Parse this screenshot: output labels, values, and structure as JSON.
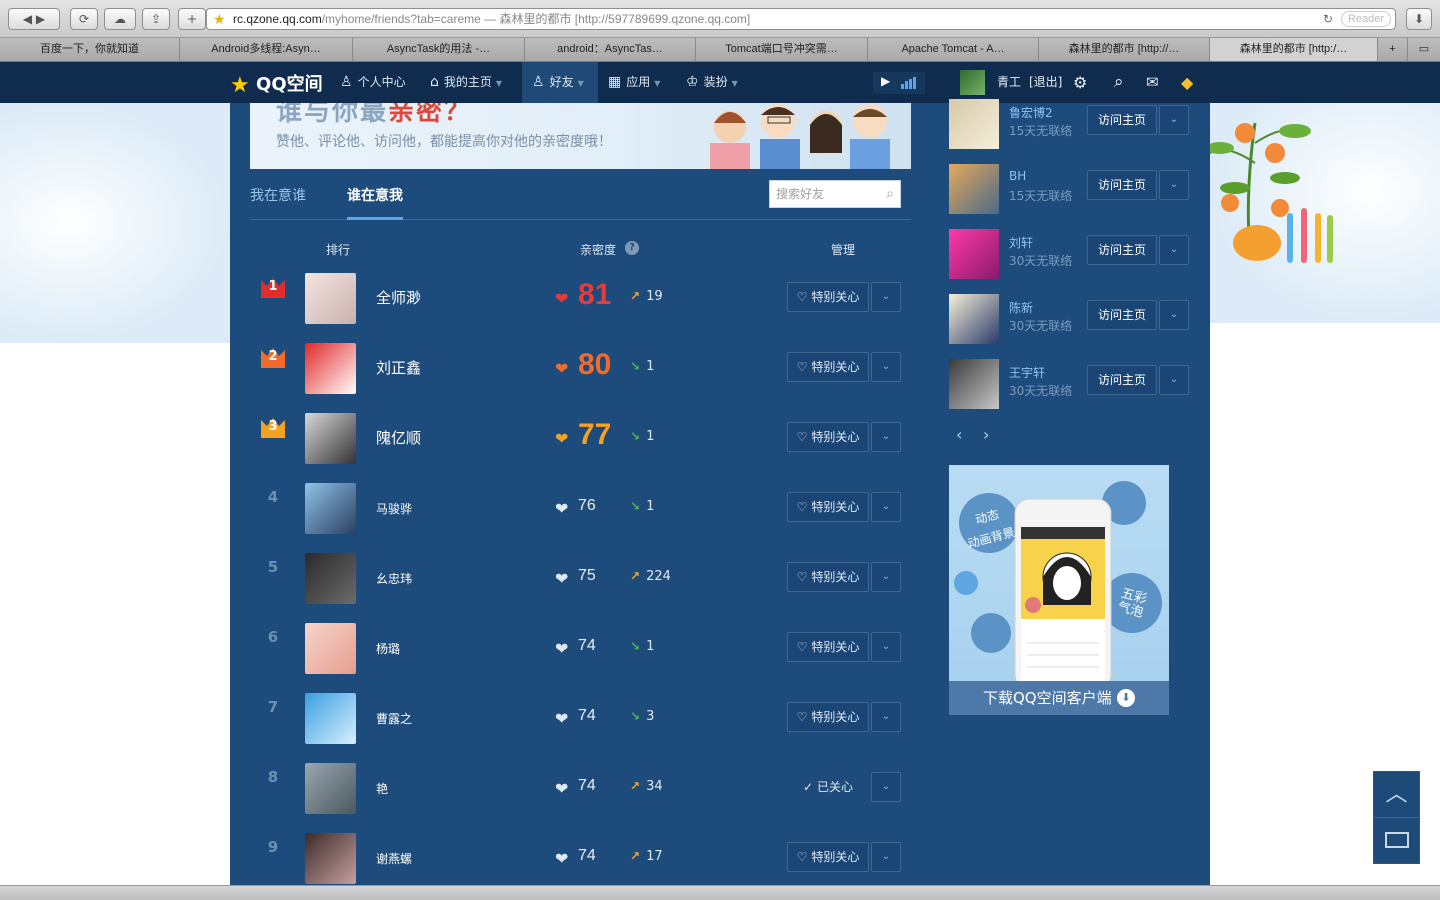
{
  "browser": {
    "url_main": "rc.qzone.qq.com",
    "url_path": "/myhome/friends?tab=careme",
    "url_title": " — 森林里的都市 [http://597789699.qzone.qq.com]",
    "reader": "Reader",
    "tabs": [
      "百度一下，你就知道",
      "Android多线程:Asyn…",
      "AsyncTask的用法 -…",
      "android：AsyncTas…",
      "Tomcat端口号冲突需…",
      "Apache Tomcat - A…",
      "森林里的都市 [http://…",
      "森林里的都市 [http:/…"
    ]
  },
  "nav": {
    "logo": "QQ空间",
    "items": [
      "个人中心",
      "我的主页",
      "好友",
      "应用",
      "装扮"
    ],
    "user": "青工",
    "logout": "[退出]"
  },
  "banner": {
    "title_a": "谁与你最",
    "title_b": "亲密？",
    "subtitle": "赞他、评论他、访问他，都能提高你对他的亲密度哦！"
  },
  "subtabs": {
    "mine": "我在意谁",
    "who": "谁在意我",
    "search_placeholder": "搜索好友"
  },
  "columns": {
    "rank": "排行",
    "intimacy": "亲密度",
    "manage": "管理"
  },
  "friends": [
    {
      "rank": "1",
      "name": "全师渺",
      "score": "81",
      "change": "19",
      "dir": "up",
      "action": "特别关心",
      "color": "#e83a3a"
    },
    {
      "rank": "2",
      "name": "刘正鑫",
      "score": "80",
      "change": "1",
      "dir": "down",
      "action": "特别关心",
      "color": "#f26b2a"
    },
    {
      "rank": "3",
      "name": "隗亿顺",
      "score": "77",
      "change": "1",
      "dir": "down",
      "action": "特别关心",
      "color": "#f4a124"
    },
    {
      "rank": "4",
      "name": "马骏骅",
      "score": "76",
      "change": "1",
      "dir": "down",
      "action": "特别关心",
      "color": "#dfe9f4"
    },
    {
      "rank": "5",
      "name": "幺忠玮",
      "score": "75",
      "change": "224",
      "dir": "up",
      "action": "特别关心",
      "color": "#dfe9f4"
    },
    {
      "rank": "6",
      "name": "杨璐",
      "score": "74",
      "change": "1",
      "dir": "down",
      "action": "特别关心",
      "color": "#dfe9f4"
    },
    {
      "rank": "7",
      "name": "曹露之",
      "score": "74",
      "change": "3",
      "dir": "down",
      "action": "特别关心",
      "color": "#dfe9f4"
    },
    {
      "rank": "8",
      "name": "艳",
      "score": "74",
      "change": "34",
      "dir": "up",
      "action": "已关心",
      "color": "#dfe9f4"
    },
    {
      "rank": "9",
      "name": "谢燕螺",
      "score": "74",
      "change": "17",
      "dir": "up",
      "action": "特别关心",
      "color": "#dfe9f4"
    }
  ],
  "sidebar": {
    "visit_label": "访问主页",
    "people": [
      {
        "name": "鲁宏博2",
        "status": "15天无联络"
      },
      {
        "name": "BH",
        "status": "15天无联络"
      },
      {
        "name": "刘轩",
        "status": "30天无联络"
      },
      {
        "name": "陈新",
        "status": "30天无联络"
      },
      {
        "name": "王宇轩",
        "status": "30天无联络"
      }
    ],
    "promo_text": "下载QQ空间客户端",
    "promo_bubble1": "动态",
    "promo_bubble1b": "动画背景",
    "promo_bubble2": "五彩气泡"
  }
}
